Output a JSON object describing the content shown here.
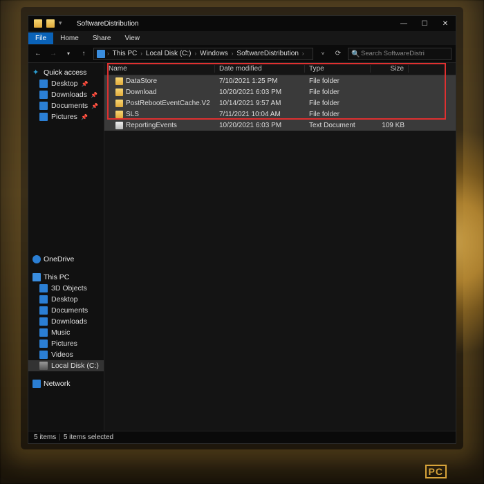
{
  "window": {
    "title": "SoftwareDistribution",
    "menus": {
      "file": "File",
      "home": "Home",
      "share": "Share",
      "view": "View"
    }
  },
  "nav": {
    "breadcrumbs": [
      "This PC",
      "Local Disk (C:)",
      "Windows",
      "SoftwareDistribution"
    ]
  },
  "search": {
    "placeholder": "Search SoftwareDistri"
  },
  "sidebar": {
    "quick_access": {
      "label": "Quick access",
      "items": [
        "Desktop",
        "Downloads",
        "Documents",
        "Pictures"
      ]
    },
    "onedrive": {
      "label": "OneDrive"
    },
    "thispc": {
      "label": "This PC",
      "items": [
        "3D Objects",
        "Desktop",
        "Documents",
        "Downloads",
        "Music",
        "Pictures",
        "Videos",
        "Local Disk (C:)"
      ]
    },
    "network": {
      "label": "Network"
    }
  },
  "columns": {
    "name": "Name",
    "date": "Date modified",
    "type": "Type",
    "size": "Size"
  },
  "files": [
    {
      "icon": "folder",
      "name": "DataStore",
      "date": "7/10/2021 1:25 PM",
      "type": "File folder",
      "size": ""
    },
    {
      "icon": "folder",
      "name": "Download",
      "date": "10/20/2021 6:03 PM",
      "type": "File folder",
      "size": ""
    },
    {
      "icon": "folder",
      "name": "PostRebootEventCache.V2",
      "date": "10/14/2021 9:57 AM",
      "type": "File folder",
      "size": ""
    },
    {
      "icon": "folder",
      "name": "SLS",
      "date": "7/11/2021 10:04 AM",
      "type": "File folder",
      "size": ""
    },
    {
      "icon": "file",
      "name": "ReportingEvents",
      "date": "10/20/2021 6:03 PM",
      "type": "Text Document",
      "size": "109 KB"
    }
  ],
  "status": {
    "count": "5 items",
    "selected": "5 items selected"
  },
  "watermark": {
    "left": "",
    "box": "PC",
    "right": ""
  }
}
